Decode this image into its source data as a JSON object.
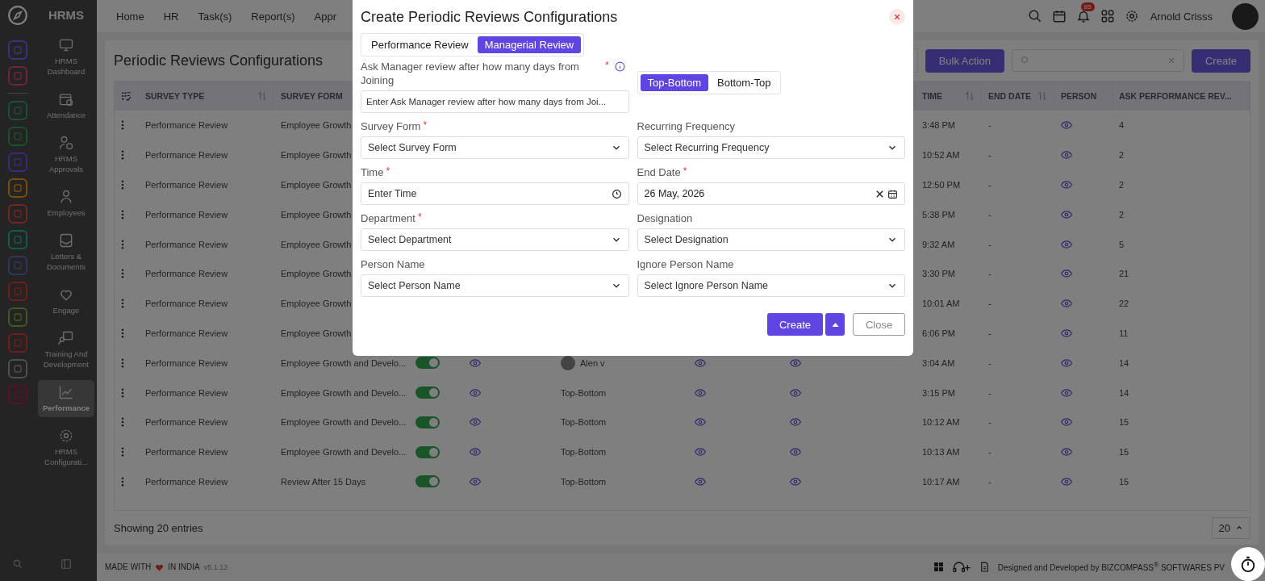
{
  "sidebar": {
    "brand": "HRMS",
    "rail": [
      {
        "color": "#363280"
      },
      {
        "color": "#70223e"
      },
      {
        "color": "#185236"
      },
      {
        "color": "#175228"
      },
      {
        "color": "#3e2780"
      },
      {
        "color": "#7a4e09"
      },
      {
        "color": "#74261e"
      },
      {
        "color": "#0d5e4e"
      },
      {
        "color": "#2e3660"
      },
      {
        "color": "#731d1b"
      },
      {
        "color": "#3e5a21"
      },
      {
        "color": "#731d1b"
      },
      {
        "color": "#4f4f4f"
      },
      {
        "color": "#610c2e"
      }
    ],
    "items": [
      {
        "label": "HRMS Dashboard",
        "selected": false
      },
      {
        "label": "Attendance",
        "selected": false
      },
      {
        "label": "HRMS Approvals",
        "selected": false
      },
      {
        "label": "Employees",
        "selected": false
      },
      {
        "label": "Letters & Documents",
        "selected": false
      },
      {
        "label": "Engage",
        "selected": false
      },
      {
        "label": "Training And Development",
        "selected": false
      },
      {
        "label": "Performance",
        "selected": true
      },
      {
        "label": "HRMS Configurati...",
        "selected": false
      }
    ]
  },
  "topnav": {
    "items": [
      "Home",
      "HR",
      "Task(s)",
      "Report(s)",
      "Appr"
    ],
    "notification_count": "85",
    "user_name": "Arnold Crisss"
  },
  "page": {
    "title": "Periodic Reviews Configurations",
    "bulk_action": "Bulk Action",
    "create": "Create"
  },
  "table": {
    "columns": [
      {
        "label": "SURVEY TYPE",
        "sortable": true
      },
      {
        "label": "SURVEY FORM"
      },
      {
        "label": "TIME",
        "sortable": true
      },
      {
        "label": "END DATE",
        "sortable": true
      },
      {
        "label": "PERSON",
        "sortable": false
      },
      {
        "label": "ASK PERFORMANCE REV...",
        "sortable": false
      }
    ],
    "rows": [
      {
        "survey_type": "Performance Review",
        "survey_form": "Employee Growth",
        "time": "3:48 PM",
        "end_date": "-",
        "ask_count": "4"
      },
      {
        "survey_type": "Performance Review",
        "survey_form": "Employee Growth",
        "time": "10:52 AM",
        "end_date": "-",
        "ask_count": "2"
      },
      {
        "survey_type": "Performance Review",
        "survey_form": "Employee Growth",
        "time": "12:50 PM",
        "end_date": "-",
        "ask_count": "2"
      },
      {
        "survey_type": "Performance Review",
        "survey_form": "Employee Growth",
        "time": "5:38 PM",
        "end_date": "-",
        "ask_count": "2"
      },
      {
        "survey_type": "Performance Review",
        "survey_form": "Employee Growth",
        "time": "9:32 AM",
        "end_date": "-",
        "ask_count": "5"
      },
      {
        "survey_type": "Performance Review",
        "survey_form": "Employee Growth",
        "time": "3:30 PM",
        "end_date": "-",
        "ask_count": "21"
      },
      {
        "survey_type": "Performance Review",
        "survey_form": "Employee Growth",
        "time": "10:01 AM",
        "end_date": "-",
        "ask_count": "22"
      },
      {
        "survey_type": "Performance Review",
        "survey_form": "Employee Growth",
        "time": "6:06 PM",
        "end_date": "-",
        "ask_count": "11"
      },
      {
        "survey_type": "Performance Review",
        "survey_form": "Employee Growth and Develo...",
        "active": true,
        "assignee": {
          "kind": "person",
          "text": "Alen v"
        },
        "time": "3:04 AM",
        "end_date": "-",
        "ask_count": "14"
      },
      {
        "survey_type": "Performance Review",
        "survey_form": "Employee Growth and Develo...",
        "active": true,
        "assignee": {
          "kind": "text",
          "text": "Top-Bottom"
        },
        "time": "3:15 PM",
        "end_date": "-",
        "ask_count": "14"
      },
      {
        "survey_type": "Performance Review",
        "survey_form": "Employee Growth and Develo...",
        "active": true,
        "assignee": {
          "kind": "text",
          "text": "Top-Bottom"
        },
        "time": "10:12 AM",
        "end_date": "-",
        "ask_count": "15"
      },
      {
        "survey_type": "Performance Review",
        "survey_form": "Employee Growth and Develo...",
        "active": true,
        "assignee": {
          "kind": "text",
          "text": "Top-Bottom"
        },
        "time": "10:13 AM",
        "end_date": "-",
        "ask_count": "15"
      },
      {
        "survey_type": "Performance Review",
        "survey_form": "Review After 15 Days",
        "active": true,
        "assignee": {
          "kind": "text",
          "text": "Top-Bottom"
        },
        "time": "10:17 AM",
        "end_date": "-",
        "ask_count": "15"
      }
    ]
  },
  "showing": "Showing 20 entries",
  "page_size": "20",
  "footer": {
    "made_with": "MADE WITH",
    "in_india": "IN INDIA",
    "version": "v5.1.12",
    "credit": "Designed and Developed by BIZCOMPASS$^{®}$ SOFTWARES PV"
  },
  "modal": {
    "title": "Create Periodic Reviews Configurations",
    "tabs": [
      {
        "label": "Performance Review",
        "selected": false
      },
      {
        "label": "Managerial Review",
        "selected": true
      }
    ],
    "days_field": {
      "label": "Ask Manager review after how many days from Joining",
      "required_mark": "*",
      "placeholder": "Enter Ask Manager review after how many days from Joi..."
    },
    "order": [
      {
        "label": "Top-Bottom",
        "selected": true
      },
      {
        "label": "Bottom-Top",
        "selected": false
      }
    ],
    "fields": [
      {
        "label": "Survey Form",
        "required_mark": "*",
        "kind": "select",
        "placeholder": "Select Survey Form"
      },
      {
        "label": "Recurring Frequency",
        "kind": "select",
        "placeholder": "Select Recurring Frequency"
      },
      {
        "label": "Time",
        "required_mark": "*",
        "kind": "time",
        "placeholder": "Enter Time"
      },
      {
        "label": "End Date",
        "required_mark": "*",
        "kind": "date",
        "value": "26 May, 2026"
      },
      {
        "label": "Department",
        "required_mark": "*",
        "kind": "select",
        "placeholder": "Select Department"
      },
      {
        "label": "Designation",
        "kind": "select",
        "placeholder": "Select Designation"
      },
      {
        "label": "Person Name",
        "kind": "select",
        "placeholder": "Select Person Name"
      },
      {
        "label": "Ignore Person Name",
        "kind": "select",
        "placeholder": "Select Ignore Person Name"
      }
    ],
    "create": "Create",
    "close": "Close"
  }
}
